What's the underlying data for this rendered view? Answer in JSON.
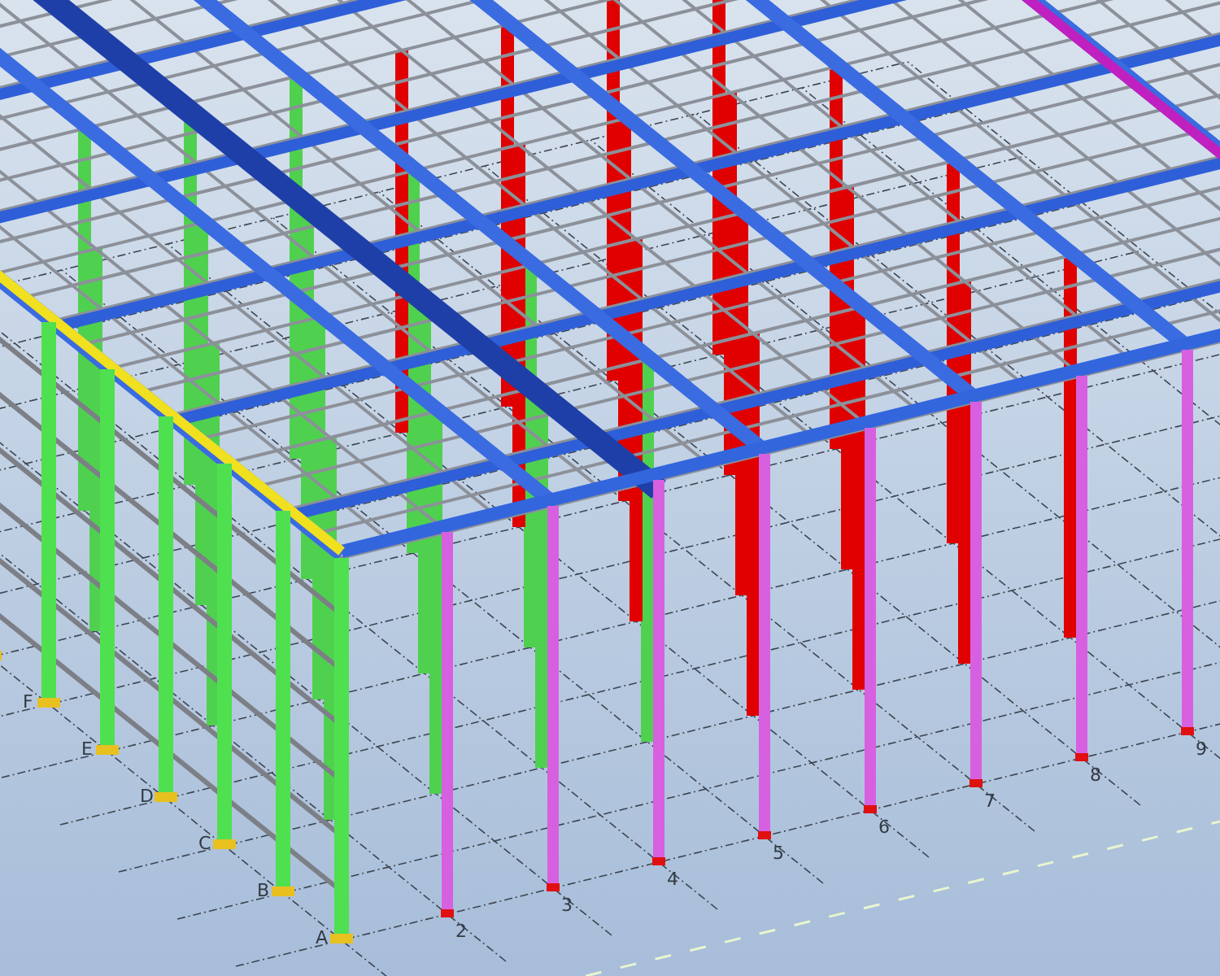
{
  "grid_axes": {
    "rows": [
      "A",
      "B",
      "C",
      "D",
      "E",
      "F"
    ],
    "columns": [
      "2",
      "3",
      "4",
      "5",
      "6",
      "7",
      "8",
      "9"
    ]
  }
}
